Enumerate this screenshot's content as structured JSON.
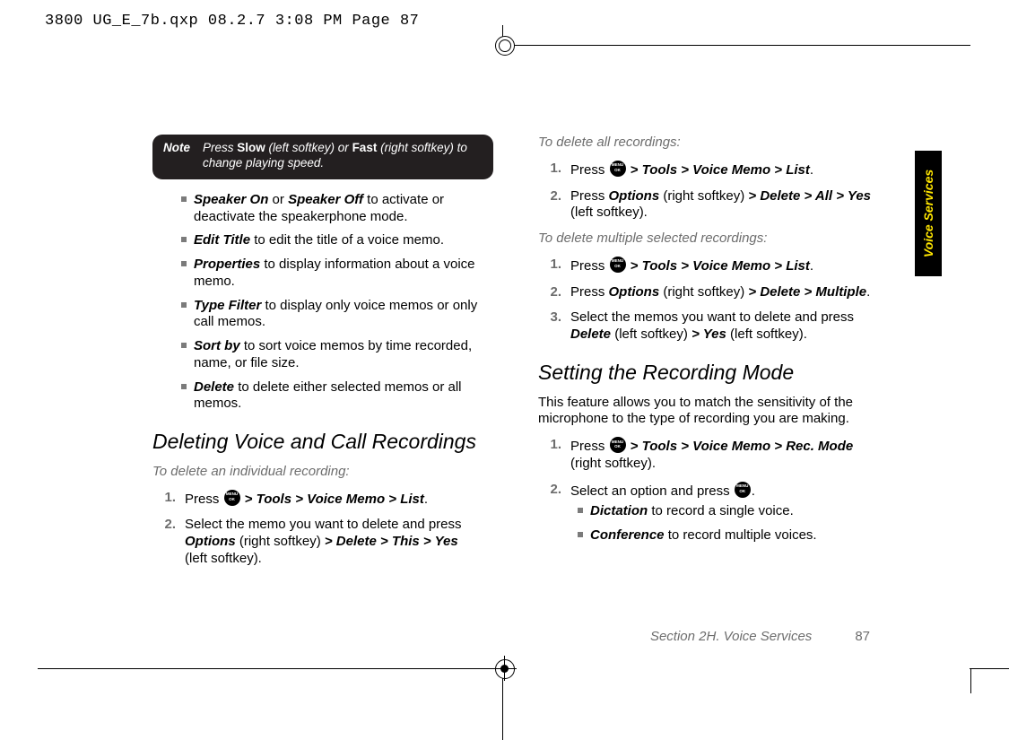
{
  "header_line": "3800 UG_E_7b.qxp  08.2.7  3:08 PM  Page 87",
  "side_tab": "Voice Services",
  "note": {
    "label": "Note",
    "pre": "Press ",
    "slow": "Slow",
    "mid1": " (left softkey) or ",
    "fast": "Fast",
    "mid2": " (right softkey) to change playing speed."
  },
  "left": {
    "bullets": [
      {
        "b": "Speaker On",
        "mid": " or ",
        "b2": "Speaker Off",
        "rest": " to activate or deactivate the speakerphone mode."
      },
      {
        "b": "Edit Title",
        "rest": " to edit the title of a voice memo."
      },
      {
        "b": "Properties",
        "rest": " to display information about a voice memo."
      },
      {
        "b": "Type Filter",
        "rest": " to display only voice memos or only call memos."
      },
      {
        "b": "Sort by",
        "rest": " to sort voice memos by time recorded, name, or file size."
      },
      {
        "b": "Delete",
        "rest": " to delete either selected memos or all memos."
      }
    ],
    "h2": "Deleting Voice and Call Recordings",
    "lead1": "To delete an individual recording:",
    "steps1": [
      {
        "n": "1.",
        "pre": "Press ",
        "path": " > Tools > Voice Memo > List",
        "post": "."
      },
      {
        "n": "2.",
        "pre": "Select the memo you want to delete and press ",
        "opt": "Options",
        "mid": " (right softkey) ",
        "path": "> Delete > This > Yes",
        "post2": " (left softkey)."
      }
    ]
  },
  "right": {
    "lead2": "To delete all recordings:",
    "steps2": [
      {
        "n": "1.",
        "pre": "Press ",
        "path": " > Tools > Voice Memo > List",
        "post": "."
      },
      {
        "n": "2.",
        "pre": "Press ",
        "opt": "Options",
        "mid": " (right softkey) ",
        "path": "> Delete > All > Yes",
        "post2": " (left softkey)."
      }
    ],
    "lead3": "To delete multiple selected recordings:",
    "steps3": [
      {
        "n": "1.",
        "pre": "Press ",
        "path": " > Tools > Voice Memo > List",
        "post": "."
      },
      {
        "n": "2.",
        "pre": "Press ",
        "opt": "Options",
        "mid": " (right softkey) ",
        "path": "> Delete > Multiple",
        "post": "."
      },
      {
        "n": "3.",
        "pre": "Select the memos you want to delete and press ",
        "opt": "Delete",
        "mid": " (left softkey) ",
        "path": "> Yes",
        "post2": " (left softkey)."
      }
    ],
    "h2b": "Setting the Recording Mode",
    "para": "This feature allows you to match the sensitivity of the microphone to the type of recording you are making.",
    "steps4": [
      {
        "n": "1.",
        "pre": "Press ",
        "path": " > Tools > Voice Memo > Rec. Mode",
        "post": " (right softkey)."
      },
      {
        "n": "2.",
        "pre": "Select an option and press ",
        "post": "."
      }
    ],
    "bullets2": [
      {
        "b": "Dictation",
        "rest": " to record a single voice."
      },
      {
        "b": "Conference",
        "rest": " to record multiple voices."
      }
    ]
  },
  "footer": {
    "section": "Section 2H. Voice Services",
    "page": "87"
  }
}
